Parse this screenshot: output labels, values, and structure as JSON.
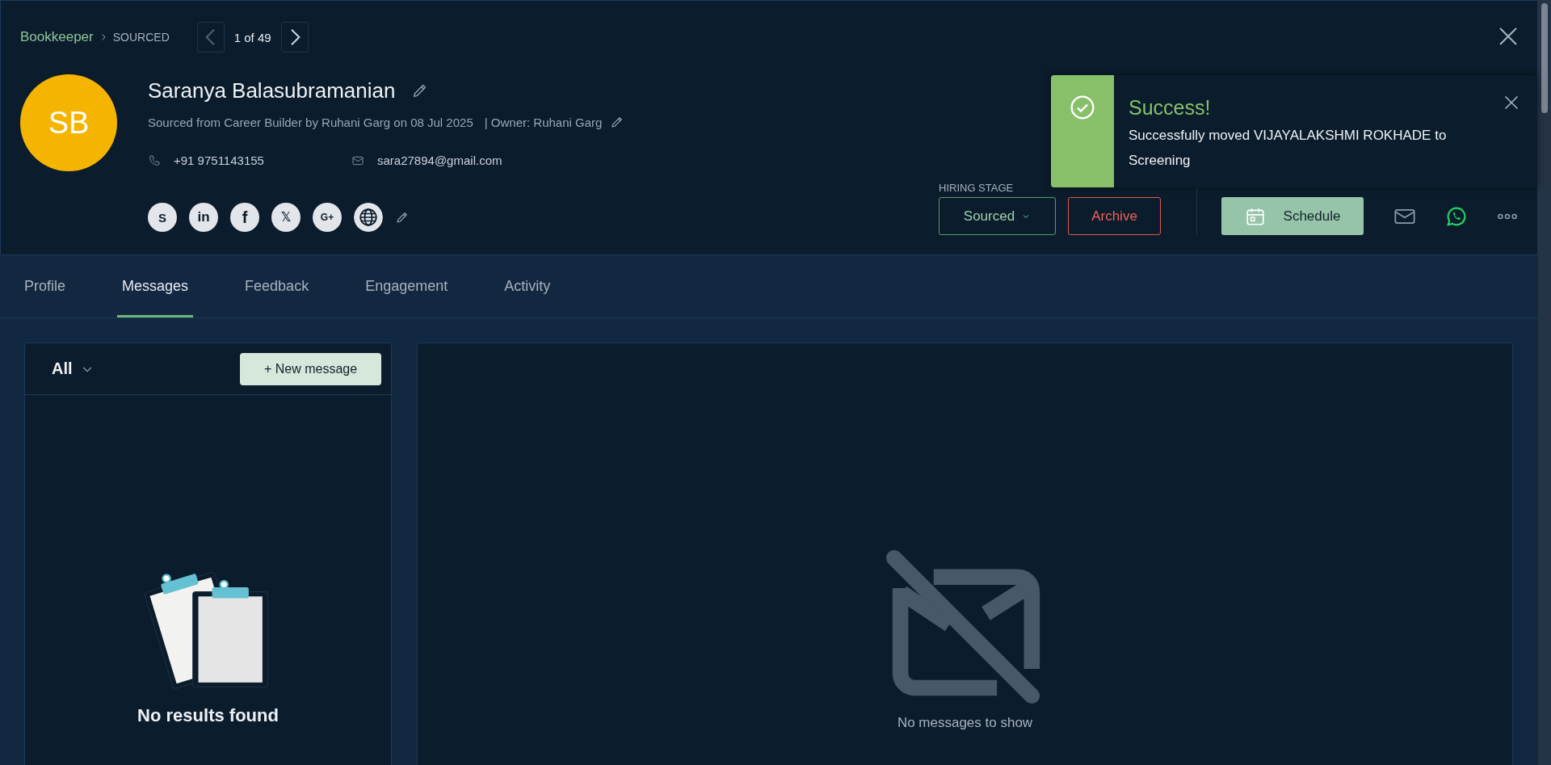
{
  "breadcrumb": {
    "job": "Bookkeeper",
    "stage": "SOURCED"
  },
  "pager": {
    "position": "1 of 49"
  },
  "candidate": {
    "initials": "SB",
    "name": "Saranya Balasubramanian",
    "source": "Sourced from Career Builder by Ruhani Garg on 08 Jul 2025",
    "owner": "| Owner: Ruhani Garg",
    "phone": "+91 9751143155",
    "email": "sara27894@gmail.com"
  },
  "social_links": [
    {
      "kind": "skype",
      "glyph": "S"
    },
    {
      "kind": "linkedin",
      "glyph": "in"
    },
    {
      "kind": "facebook",
      "glyph": "f"
    },
    {
      "kind": "x",
      "glyph": "𝕏"
    },
    {
      "kind": "google-plus",
      "glyph": "G+"
    },
    {
      "kind": "globe"
    }
  ],
  "hiring_stage": {
    "label": "HIRING STAGE",
    "value": "Sourced",
    "archive": "Archive"
  },
  "interactions": {
    "schedule": "Schedule"
  },
  "toast": {
    "title": "Success!",
    "message": "Successfully moved VIJAYALAKSHMI ROKHADE to Screening"
  },
  "tabs": [
    {
      "label": "Profile",
      "selected": false
    },
    {
      "label": "Messages",
      "selected": true
    },
    {
      "label": "Feedback",
      "selected": false
    },
    {
      "label": "Engagement",
      "selected": false
    },
    {
      "label": "Activity",
      "selected": false
    }
  ],
  "messages_panel": {
    "filter": "All",
    "new_button": "+ New message",
    "empty_text": "No results found"
  },
  "thread_panel": {
    "empty_text": "No messages to show"
  }
}
